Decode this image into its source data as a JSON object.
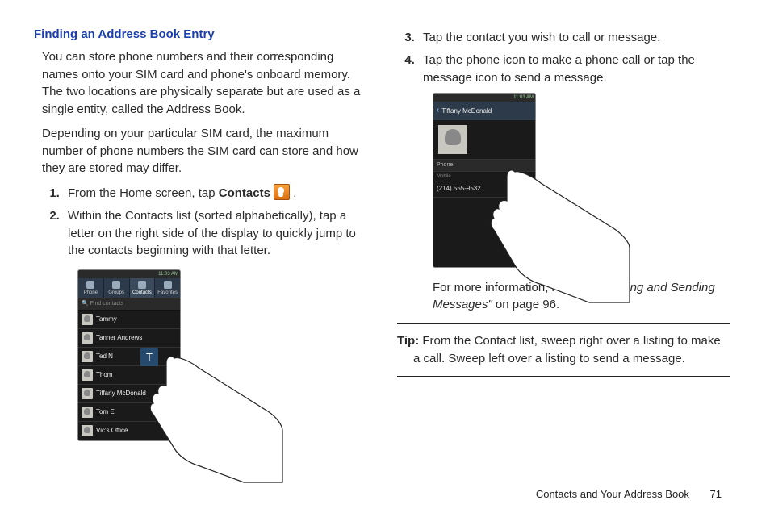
{
  "section_title": "Finding an Address Book Entry",
  "intro_p1": "You can store phone numbers and their corresponding names onto your SIM card and phone's onboard memory. The two locations are physically separate but are used as a single entity, called the Address Book.",
  "intro_p2": "Depending on your particular SIM card, the maximum number of phone numbers the SIM card can store and how they are stored may differ.",
  "step1_a": "From the Home screen, tap ",
  "step1_b": "Contacts",
  "step1_c": " .",
  "step2": "Within the Contacts list (sorted alphabetically), tap a letter on the right side of the display to quickly jump to the contacts beginning with that letter.",
  "step3": "Tap the contact you wish to call or message.",
  "step4": "Tap the phone icon to make a phone call or tap the message icon to send a message.",
  "ref_a": "For more information, refer to ",
  "ref_b": "\"Creating and Sending Messages\"",
  "ref_c": "  on page 96.",
  "tip_label": "Tip:",
  "tip_text": " From the Contact list, sweep right over a listing to make a call. Sweep left over a listing to send a message.",
  "footer_chapter": "Contacts and Your Address Book",
  "footer_page": "71",
  "phone1": {
    "status": "11:03 AM",
    "tabs": [
      "Phone",
      "Groups",
      "Contacts",
      "Favorites"
    ],
    "search": "🔍 Find contacts",
    "rows": [
      "Tammy",
      "Tanner Andrews",
      "Ted N",
      "Thom",
      "Tiffany McDonald",
      "Tom E",
      "Vic's Office"
    ],
    "popup": "T"
  },
  "phone2": {
    "status": "11:03 AM",
    "back": "Tiffany  McDonald",
    "section": "Phone",
    "subsection": "Mobile",
    "number": "(214) 555-9532"
  }
}
